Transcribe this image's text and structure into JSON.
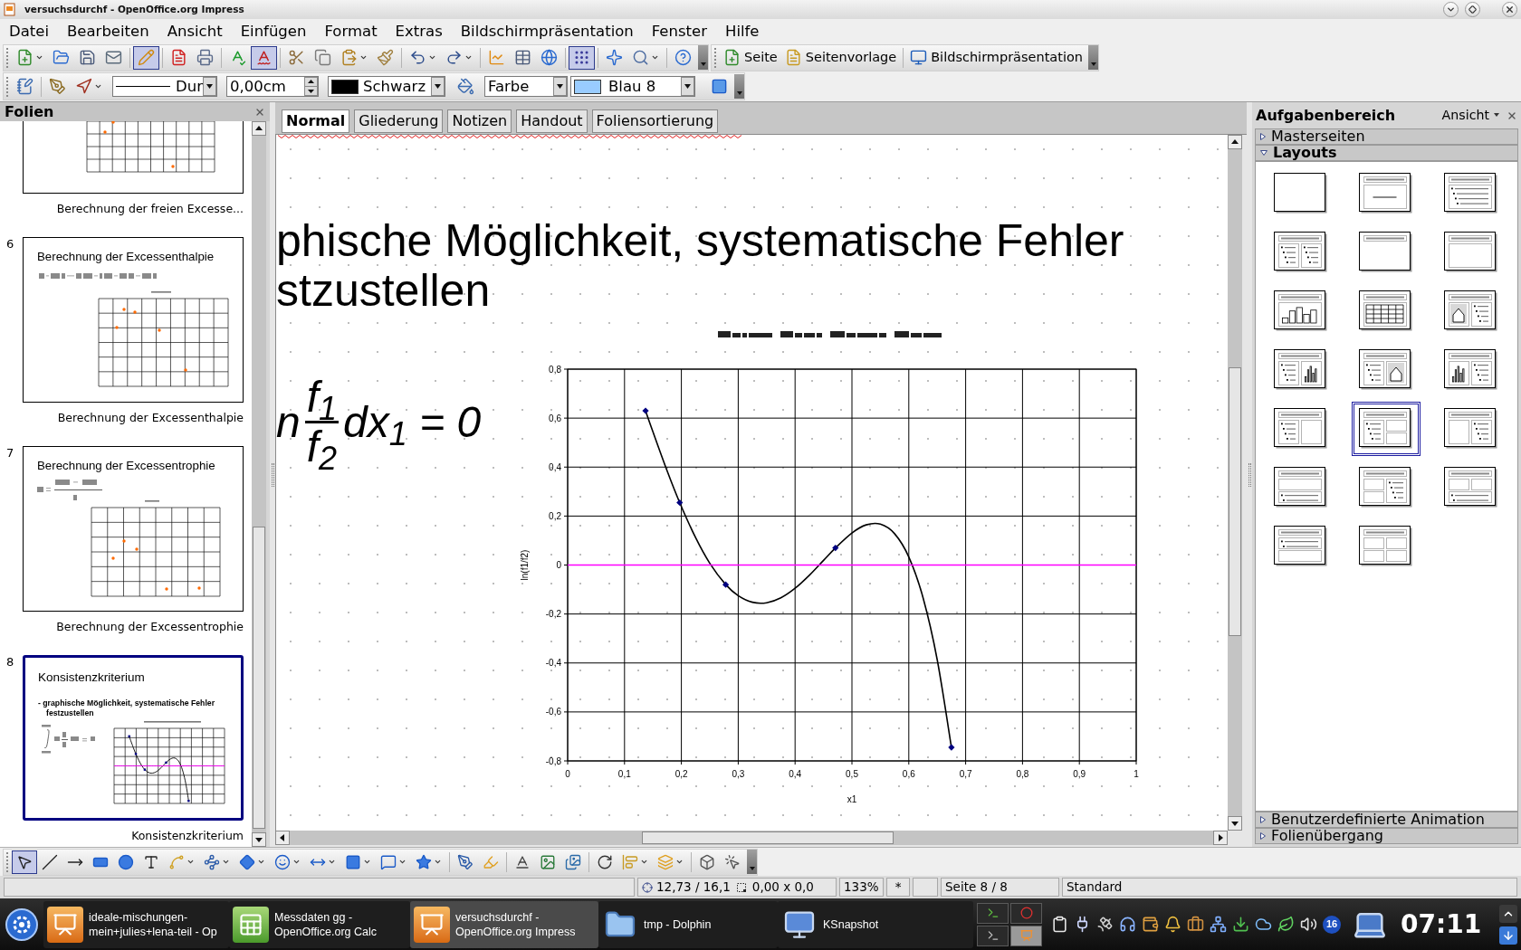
{
  "window": {
    "title": "versuchsdurchf - OpenOffice.org Impress"
  },
  "menu": [
    {
      "label": "Datei"
    },
    {
      "label": "Bearbeiten"
    },
    {
      "label": "Ansicht"
    },
    {
      "label": "Einfügen"
    },
    {
      "label": "Format"
    },
    {
      "label": "Extras"
    },
    {
      "label": "Bildschirmpräsentation"
    },
    {
      "label": "Fenster"
    },
    {
      "label": "Hilfe"
    }
  ],
  "standard_toolbar": {
    "buttons": [
      {
        "pressed": false,
        "dropdown": true
      },
      {
        "pressed": false,
        "dropdown": false
      },
      {
        "pressed": false,
        "dropdown": false
      },
      {
        "pressed": false,
        "dropdown": false
      },
      {
        "pressed": true,
        "dropdown": false
      },
      {
        "pressed": false,
        "dropdown": false
      },
      {
        "pressed": false,
        "dropdown": false
      },
      {
        "pressed": false,
        "dropdown": false
      },
      {
        "pressed": true,
        "dropdown": false
      },
      {
        "pressed": false,
        "dropdown": false
      },
      {
        "pressed": false,
        "dropdown": false
      },
      {
        "pressed": false,
        "dropdown": true
      },
      {
        "pressed": false,
        "dropdown": false
      },
      {
        "pressed": false,
        "dropdown": true
      },
      {
        "pressed": false,
        "dropdown": true
      },
      {
        "pressed": false,
        "dropdown": false
      },
      {
        "pressed": false,
        "dropdown": false
      },
      {
        "pressed": false,
        "dropdown": false
      },
      {
        "pressed": true,
        "dropdown": false
      },
      {
        "pressed": false,
        "dropdown": false
      },
      {
        "pressed": false,
        "dropdown": true
      },
      {
        "pressed": false,
        "dropdown": false
      }
    ],
    "text_buttons": [
      {
        "label": "Seite"
      },
      {
        "label": "Seitenvorlage"
      },
      {
        "label": "Bildschirmpräsentation"
      }
    ]
  },
  "line_toolbar": {
    "buttons": [
      {
        "pressed": false,
        "dropdown": false
      },
      {
        "pressed": false,
        "dropdown": false
      },
      {
        "pressed": false,
        "dropdown": true
      },
      {
        "pressed": false,
        "dropdown": false
      },
      {
        "pressed": false,
        "dropdown": false
      }
    ],
    "line_style": "Dur",
    "line_width": "0,00cm",
    "line_color": {
      "label": "Schwarz",
      "color": "#000000"
    },
    "area_style": "Farbe",
    "area_color": {
      "label": "Blau 8",
      "color": "#99ccff"
    }
  },
  "slides_panel": {
    "title": "Folien",
    "slides": [
      {
        "kind": "chart-cut",
        "caption": "Berechnung der freien Excesse...",
        "selected": false
      },
      {
        "kind": "formula-chart",
        "number": "6",
        "title": "Berechnung der Excessenthalpie",
        "caption": "Berechnung der Excessenthalpie",
        "selected": false
      },
      {
        "kind": "formula-chart",
        "number": "7",
        "title": "Berechnung der Excessentrophie",
        "caption": "Berechnung der Excessentrophie",
        "selected": false
      },
      {
        "kind": "bullet-chart",
        "number": "8",
        "title": "Konsistenzkriterium",
        "bullet_lines": [
          "- graphische Möglichkeit, systematische Fehler",
          "festzustellen"
        ],
        "caption": "Konsistenzkriterium",
        "selected": true
      }
    ]
  },
  "view_tabs": [
    {
      "label": "Normal",
      "selected": true
    },
    {
      "label": "Gliederung",
      "selected": false
    },
    {
      "label": "Notizen",
      "selected": false
    },
    {
      "label": "Handout",
      "selected": false
    },
    {
      "label": "Foliensortierung",
      "selected": false
    }
  ],
  "slide": {
    "bullet_lines": [
      "phische Möglichkeit, systematische Fehler",
      "stzustellen"
    ],
    "formula": {
      "lead": "n",
      "numerator": "f$_{1}$",
      "denominator": "f$_{2}$",
      "tail": "dx$_{1}$ = 0"
    },
    "chart_data": {
      "type": "scatter",
      "xlabel": "x1",
      "ylabel": "ln(f1/f2)",
      "grid": true,
      "x": [
        0,
        0.137,
        0.15,
        0.175,
        0.197,
        0.225,
        0.25,
        0.278,
        0.3,
        0.325,
        0.35,
        0.375,
        0.4,
        0.425,
        0.45,
        0.471,
        0.5,
        0.525,
        0.55,
        0.575,
        0.6,
        0.625,
        0.65,
        0.675,
        1
      ],
      "series": [
        {
          "color": "#000080",
          "values": [
            null,
            0.63,
            null,
            null,
            0.255,
            null,
            null,
            -0.08,
            null,
            null,
            null,
            null,
            null,
            null,
            null,
            0.07,
            null,
            null,
            null,
            null,
            null,
            null,
            null,
            -0.745,
            null
          ]
        },
        {
          "type": "line",
          "color": "#000000",
          "values": [
            null,
            0.63,
            0.544,
            0.384,
            0.255,
            0.112,
            0.007,
            -0.08,
            -0.125,
            -0.152,
            -0.154,
            -0.134,
            -0.095,
            -0.042,
            0.019,
            0.07,
            0.131,
            0.164,
            0.167,
            0.128,
            0.033,
            -0.133,
            -0.387,
            -0.745,
            null
          ]
        },
        {
          "type": "line",
          "color": "#ff00ff",
          "values": [
            0,
            0,
            0,
            0,
            0,
            0,
            0,
            0,
            0,
            0,
            0,
            0,
            0,
            0,
            0,
            0,
            0,
            0,
            0,
            0,
            0,
            0,
            0,
            0,
            0
          ]
        }
      ],
      "xlim": [
        0,
        1
      ],
      "ylim": [
        -0.8,
        0.8
      ],
      "xticks": [
        {
          "value": 0,
          "label": "0"
        },
        {
          "value": 0.1,
          "label": "0,1"
        },
        {
          "value": 0.2,
          "label": "0,2"
        },
        {
          "value": 0.3,
          "label": "0,3"
        },
        {
          "value": 0.4,
          "label": "0,4"
        },
        {
          "value": 0.5,
          "label": "0,5"
        },
        {
          "value": 0.6,
          "label": "0,6"
        },
        {
          "value": 0.7,
          "label": "0,7"
        },
        {
          "value": 0.8,
          "label": "0,8"
        },
        {
          "value": 0.9,
          "label": "0,9"
        },
        {
          "value": 1,
          "label": "1"
        }
      ],
      "yticks": [
        {
          "value": 0.8,
          "label": "0,8"
        },
        {
          "value": 0.6,
          "label": "0,6"
        },
        {
          "value": 0.4,
          "label": "0,4"
        },
        {
          "value": 0.2,
          "label": "0,2"
        },
        {
          "value": 0,
          "label": "0"
        },
        {
          "value": -0.2,
          "label": "-0,2"
        },
        {
          "value": -0.4,
          "label": "-0,4"
        },
        {
          "value": -0.6,
          "label": "-0,6"
        },
        {
          "value": -0.8,
          "label": "-0,8"
        }
      ]
    }
  },
  "task_pane": {
    "title": "Aufgabenbereich",
    "view_menu": "Ansicht",
    "sections": [
      {
        "label": "Masterseiten",
        "expanded": false
      },
      {
        "label": "Layouts",
        "expanded": true
      }
    ],
    "layouts": [
      {
        "kind": "blank",
        "selected": false
      },
      {
        "kind": "title-subtitle",
        "selected": false
      },
      {
        "kind": "title-bullets",
        "selected": false
      },
      {
        "kind": "title-bulletpair",
        "selected": false
      },
      {
        "kind": "title-only",
        "selected": false
      },
      {
        "kind": "title-box",
        "selected": false
      },
      {
        "kind": "title-chart",
        "selected": false
      },
      {
        "kind": "title-table",
        "selected": false
      },
      {
        "kind": "clip-bullets",
        "selected": false
      },
      {
        "kind": "bullets-chart",
        "selected": false
      },
      {
        "kind": "bullets-clip",
        "selected": false
      },
      {
        "kind": "chart-bullets",
        "selected": false
      },
      {
        "kind": "bullets-box",
        "selected": false
      },
      {
        "kind": "bullets-boxpair",
        "selected": true
      },
      {
        "kind": "box-bullets",
        "selected": false
      },
      {
        "kind": "box-over-bullets",
        "selected": false
      },
      {
        "kind": "boxpair-bullets",
        "selected": false
      },
      {
        "kind": "boxpair-over-bullets",
        "selected": false
      },
      {
        "kind": "bullets-over-box",
        "selected": false
      },
      {
        "kind": "quadboxes",
        "selected": false
      }
    ],
    "more_sections": [
      {
        "label": "Benutzerdefinierte Animation",
        "expanded": false
      },
      {
        "label": "Folienübergang",
        "expanded": false
      }
    ]
  },
  "drawing_toolbar": {
    "buttons": [
      {
        "pressed": true,
        "dropdown": false
      },
      {
        "pressed": false,
        "dropdown": false
      },
      {
        "pressed": false,
        "dropdown": false
      },
      {
        "pressed": false,
        "dropdown": false
      },
      {
        "pressed": false,
        "dropdown": false
      },
      {
        "pressed": false,
        "dropdown": false
      },
      {
        "pressed": false,
        "dropdown": true
      },
      {
        "pressed": false,
        "dropdown": true
      },
      {
        "pressed": false,
        "dropdown": true
      },
      {
        "pressed": false,
        "dropdown": true
      },
      {
        "pressed": false,
        "dropdown": true
      },
      {
        "pressed": false,
        "dropdown": true
      },
      {
        "pressed": false,
        "dropdown": true
      },
      {
        "pressed": false,
        "dropdown": true
      },
      {
        "pressed": false,
        "dropdown": false
      },
      {
        "pressed": false,
        "dropdown": false
      },
      {
        "pressed": false,
        "dropdown": false
      },
      {
        "pressed": false,
        "dropdown": false
      },
      {
        "pressed": false,
        "dropdown": false
      },
      {
        "pressed": false,
        "dropdown": false
      },
      {
        "pressed": false,
        "dropdown": true
      },
      {
        "pressed": false,
        "dropdown": true
      },
      {
        "pressed": false,
        "dropdown": false
      },
      {
        "pressed": false,
        "dropdown": false
      }
    ]
  },
  "status_bar": {
    "position": "12,73 / 16,1",
    "size": "0,00 x 0,0",
    "zoom": "133%",
    "modified": "*",
    "page": "Seite 8 / 8",
    "layout": "Standard"
  },
  "taskbar": {
    "tasks": [
      {
        "kind": "impress",
        "lines": [
          "ideale-mischungen-",
          "mein+julies+lena-teil - Op"
        ],
        "selected": false
      },
      {
        "kind": "calc",
        "lines": [
          "Messdaten gg -",
          "OpenOffice.org Calc"
        ],
        "selected": false
      },
      {
        "kind": "impress",
        "lines": [
          "versuchsdurchf -",
          "OpenOffice.org Impress"
        ],
        "selected": true
      },
      {
        "kind": "folder",
        "lines": [
          "tmp - Dolphin"
        ],
        "selected": false
      },
      {
        "kind": "snapshot",
        "lines": [
          "KSnapshot"
        ],
        "selected": false
      }
    ],
    "pager": [
      {
        "selected": false
      },
      {
        "selected": false
      },
      {
        "selected": false
      },
      {
        "selected": true
      }
    ],
    "tray_badge": "16",
    "clock": "07:11"
  }
}
